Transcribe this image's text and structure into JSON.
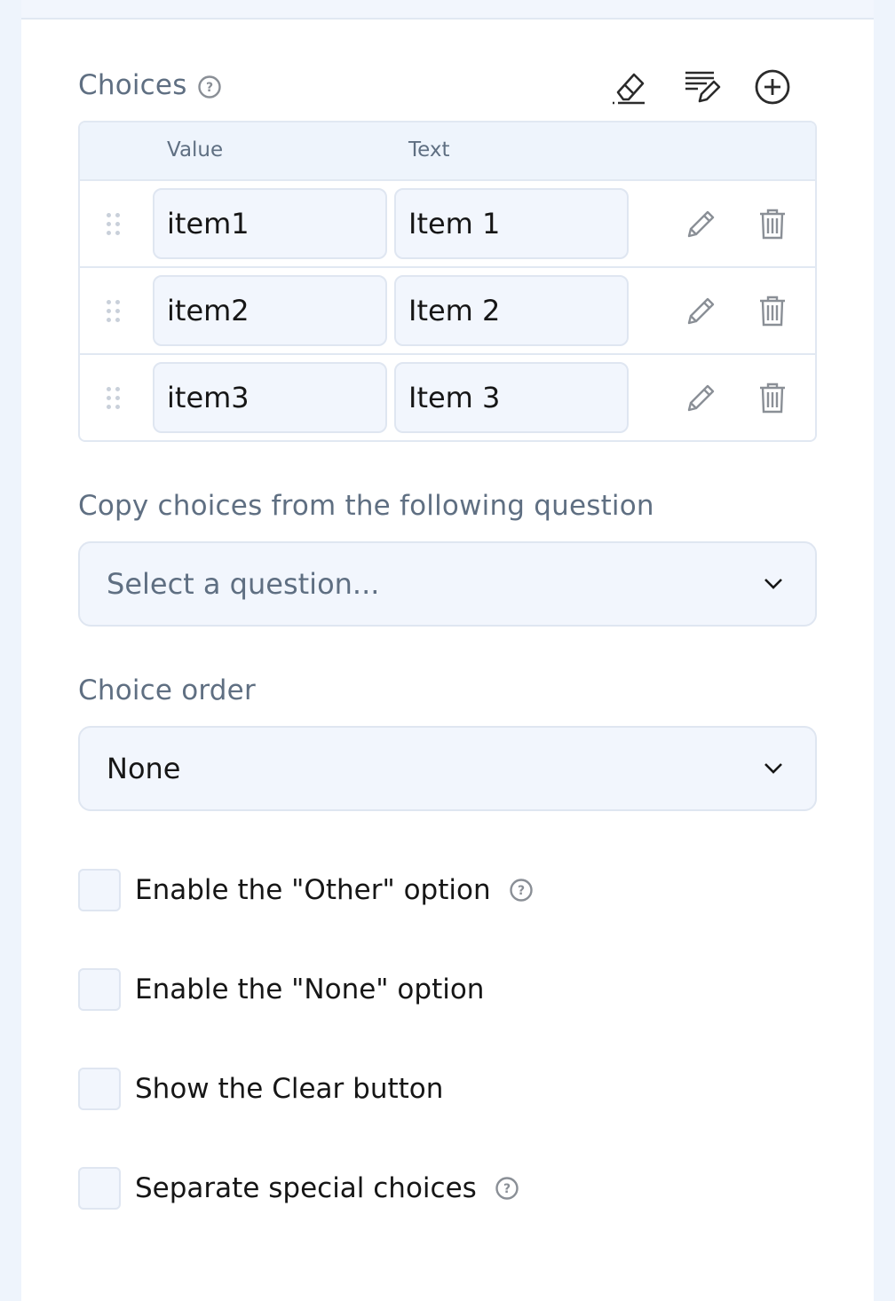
{
  "choices": {
    "title": "Choices",
    "columns": {
      "value": "Value",
      "text": "Text"
    },
    "items": [
      {
        "value": "item1",
        "text": "Item 1"
      },
      {
        "value": "item2",
        "text": "Item 2"
      },
      {
        "value": "item3",
        "text": "Item 3"
      }
    ],
    "toolbar_icons": [
      "eraser-icon",
      "edit-list-icon",
      "add-circle-icon"
    ],
    "row_icons": [
      "drag-handle-icon",
      "pencil-icon",
      "trash-icon"
    ]
  },
  "copy_choices": {
    "label": "Copy choices from the following question",
    "placeholder": "Select a question..."
  },
  "choice_order": {
    "label": "Choice order",
    "value": "None"
  },
  "options": [
    {
      "label": "Enable the \"Other\" option",
      "checked": false,
      "help": true
    },
    {
      "label": "Enable the \"None\" option",
      "checked": false,
      "help": false
    },
    {
      "label": "Show the Clear button",
      "checked": false,
      "help": false
    },
    {
      "label": "Separate special choices",
      "checked": false,
      "help": true
    }
  ],
  "colors": {
    "label": "#5f6f82",
    "field_bg": "#f2f6fd",
    "border": "#e1e8f2",
    "icon": "#8a8f96"
  }
}
